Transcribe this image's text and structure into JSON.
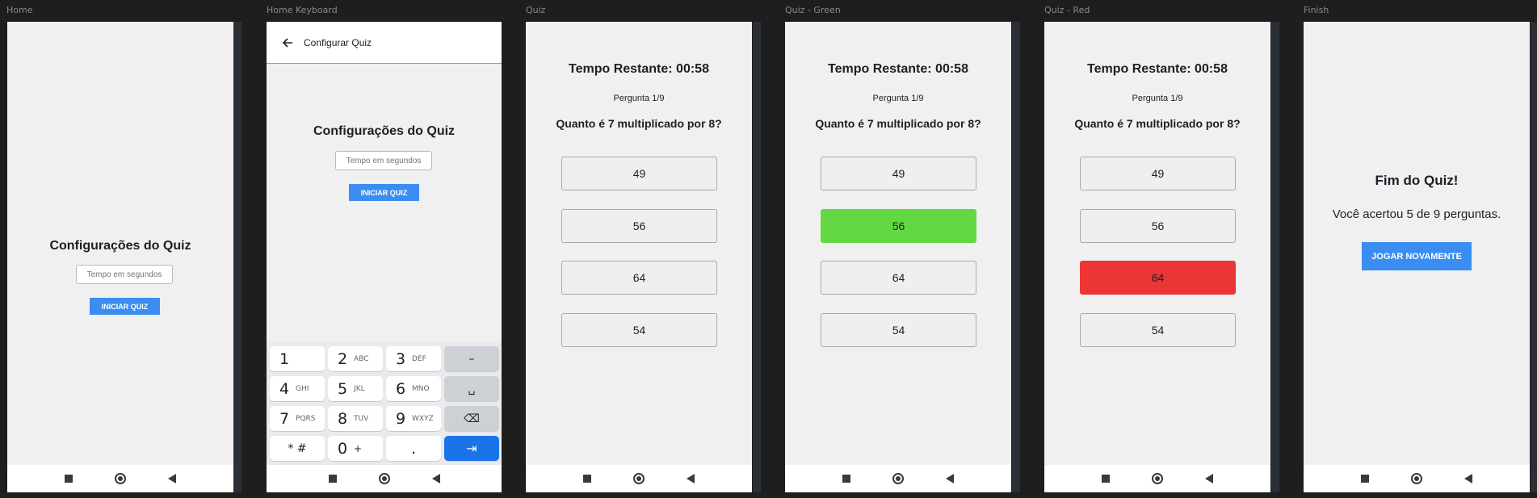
{
  "frames": {
    "home": "Home",
    "home_keyboard": "Home Keyboard",
    "quiz": "Quiz",
    "quiz_green": "Quiz - Green",
    "quiz_red": "Quiz - Red",
    "finish": "Finish"
  },
  "config": {
    "title": "Configurações do Quiz",
    "input_placeholder": "Tempo em segundos",
    "start_button": "INICIAR QUIZ"
  },
  "appbar": {
    "title": "Configurar Quiz",
    "back_icon": "arrow-left-icon"
  },
  "keyboard": {
    "rows": [
      [
        {
          "main": "1",
          "sub": ""
        },
        {
          "main": "2",
          "sub": "ABC"
        },
        {
          "main": "3",
          "sub": "DEF"
        },
        {
          "main": "–",
          "sub": ""
        }
      ],
      [
        {
          "main": "4",
          "sub": "GHI"
        },
        {
          "main": "5",
          "sub": "JKL"
        },
        {
          "main": "6",
          "sub": "MNO"
        },
        {
          "main": "␣",
          "sub": ""
        }
      ],
      [
        {
          "main": "7",
          "sub": "PQRS"
        },
        {
          "main": "8",
          "sub": "TUV"
        },
        {
          "main": "9",
          "sub": "WXYZ"
        },
        {
          "main": "⌫",
          "sub": ""
        }
      ],
      [
        {
          "main": "* #",
          "sub": ""
        },
        {
          "main": "0",
          "sub": "+"
        },
        {
          "main": ".",
          "sub": ""
        },
        {
          "main": "⇥",
          "sub": ""
        }
      ]
    ]
  },
  "quiz": {
    "timer": "Tempo Restante: 00:58",
    "counter": "Pergunta 1/9",
    "question": "Quanto é 7 multiplicado por 8?",
    "answers": [
      "49",
      "56",
      "64",
      "54"
    ]
  },
  "colors": {
    "correct": "#62d943",
    "wrong": "#ec3535",
    "accent": "#3b8df1"
  },
  "finish": {
    "title": "Fim do Quiz!",
    "result": "Você acertou 5 de 9 perguntas.",
    "replay_button": "JOGAR NOVAMENTE"
  },
  "navbar": {
    "recent": "square-icon",
    "home": "circle-icon",
    "back": "triangle-back-icon"
  }
}
